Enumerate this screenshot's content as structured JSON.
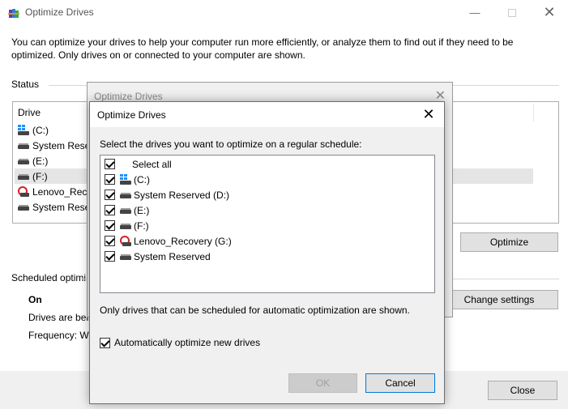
{
  "window": {
    "title": "Optimize Drives",
    "description": "You can optimize your drives to help your computer run more efficiently, or analyze them to find out if they need to be optimized. Only drives on or connected to your computer are shown.",
    "status_label": "Status",
    "column_drive": "Drive",
    "drives": [
      {
        "label": "(C:)",
        "icon": "windows-drive-icon"
      },
      {
        "label": "System Reser",
        "icon": "hard-drive-icon"
      },
      {
        "label": "(E:)",
        "icon": "hard-drive-icon"
      },
      {
        "label": "(F:)",
        "icon": "hard-drive-icon"
      },
      {
        "label": "Lenovo_Reco",
        "icon": "recovery-drive-icon"
      },
      {
        "label": "System Reser",
        "icon": "hard-drive-icon"
      }
    ],
    "optimize_button": "Optimize",
    "scheduled_label": "Scheduled optimi",
    "schedule_state": "On",
    "drives_being": "Drives are bein",
    "frequency": "Frequency: We",
    "change_settings_button": "Change settings",
    "close_button": "Close"
  },
  "background_dialog": {
    "title": "Optimize Drives"
  },
  "dialog": {
    "title": "Optimize Drives",
    "instruction": "Select the drives you want to optimize on a regular schedule:",
    "select_all": "Select all",
    "items": [
      {
        "label": "(C:)",
        "icon": "windows-drive-icon",
        "checked": true
      },
      {
        "label": "System Reserved (D:)",
        "icon": "hard-drive-icon",
        "checked": true
      },
      {
        "label": "(E:)",
        "icon": "hard-drive-icon",
        "checked": true
      },
      {
        "label": "(F:)",
        "icon": "hard-drive-icon",
        "checked": true
      },
      {
        "label": "Lenovo_Recovery (G:)",
        "icon": "recovery-drive-icon",
        "checked": true
      },
      {
        "label": "System Reserved",
        "icon": "hard-drive-icon",
        "checked": true
      }
    ],
    "note": "Only drives that can be scheduled for automatic optimization are shown.",
    "auto_optimize_label": "Automatically optimize new drives",
    "auto_optimize_checked": true,
    "ok_button": "OK",
    "cancel_button": "Cancel"
  }
}
